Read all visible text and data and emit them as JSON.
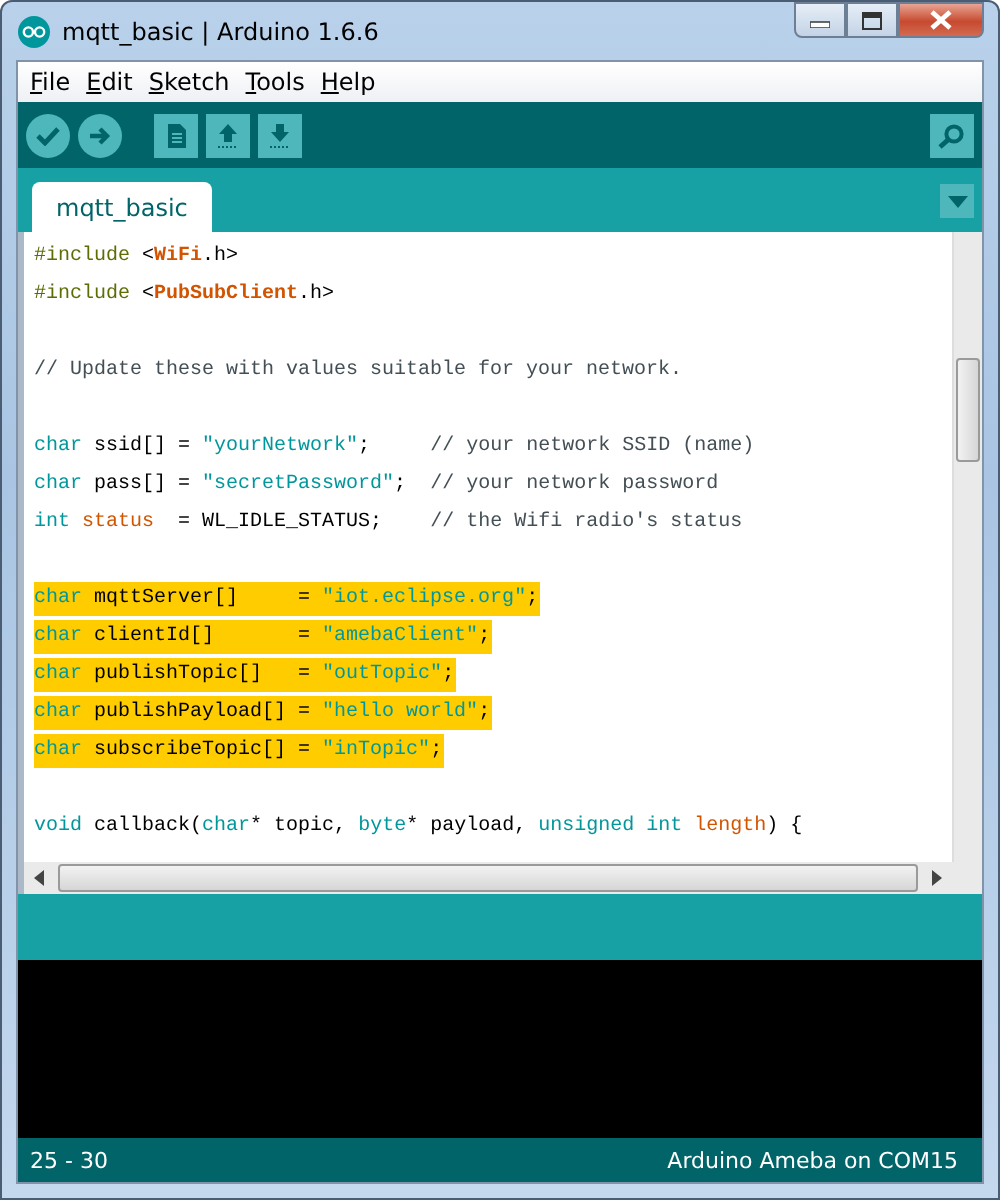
{
  "window": {
    "title": "mqtt_basic | Arduino 1.6.6"
  },
  "menu": [
    "File",
    "Edit",
    "Sketch",
    "Tools",
    "Help"
  ],
  "tabs": [
    {
      "label": "mqtt_basic",
      "selected": true
    }
  ],
  "code": {
    "lines": [
      {
        "highlighted": false,
        "tokens": [
          {
            "kind": "preprocessor",
            "text": "#include"
          },
          {
            "kind": "plain",
            "text": " <"
          },
          {
            "kind": "library",
            "text": "WiFi"
          },
          {
            "kind": "plain",
            "text": ".h>"
          }
        ]
      },
      {
        "highlighted": false,
        "tokens": [
          {
            "kind": "preprocessor",
            "text": "#include"
          },
          {
            "kind": "plain",
            "text": " <"
          },
          {
            "kind": "library",
            "text": "PubSubClient"
          },
          {
            "kind": "plain",
            "text": ".h>"
          }
        ]
      },
      {
        "highlighted": false
      },
      {
        "highlighted": false,
        "tokens": [
          {
            "kind": "comment",
            "text": "// Update these with values suitable for your network."
          }
        ]
      },
      {
        "highlighted": false
      },
      {
        "highlighted": false,
        "tokens": [
          {
            "kind": "keyword",
            "text": "char"
          },
          {
            "kind": "plain",
            "text": " ssid[] = "
          },
          {
            "kind": "string",
            "text": "\"yourNetwork\""
          },
          {
            "kind": "plain",
            "text": ";     "
          },
          {
            "kind": "comment",
            "text": "// your network SSID (name)"
          }
        ]
      },
      {
        "highlighted": false,
        "tokens": [
          {
            "kind": "keyword",
            "text": "char"
          },
          {
            "kind": "plain",
            "text": " pass[] = "
          },
          {
            "kind": "string",
            "text": "\"secretPassword\""
          },
          {
            "kind": "plain",
            "text": ";  "
          },
          {
            "kind": "comment",
            "text": "// your network password"
          }
        ]
      },
      {
        "highlighted": false,
        "tokens": [
          {
            "kind": "keyword",
            "text": "int "
          },
          {
            "kind": "variable",
            "text": "status"
          },
          {
            "kind": "plain",
            "text": "  = WL_IDLE_STATUS;    "
          },
          {
            "kind": "comment",
            "text": "// the Wifi radio's status"
          }
        ]
      },
      {
        "highlighted": false
      },
      {
        "highlighted": true,
        "tokens": [
          {
            "kind": "keyword",
            "text": "char"
          },
          {
            "kind": "plain",
            "text": " mqttServer[]     = "
          },
          {
            "kind": "string",
            "text": "\"iot.eclipse.org\""
          },
          {
            "kind": "plain",
            "text": ";"
          }
        ]
      },
      {
        "highlighted": true,
        "tokens": [
          {
            "kind": "keyword",
            "text": "char"
          },
          {
            "kind": "plain",
            "text": " clientId[]       = "
          },
          {
            "kind": "string",
            "text": "\"amebaClient\""
          },
          {
            "kind": "plain",
            "text": ";"
          }
        ]
      },
      {
        "highlighted": true,
        "tokens": [
          {
            "kind": "keyword",
            "text": "char"
          },
          {
            "kind": "plain",
            "text": " publishTopic[]   = "
          },
          {
            "kind": "string",
            "text": "\"outTopic\""
          },
          {
            "kind": "plain",
            "text": ";"
          }
        ]
      },
      {
        "highlighted": true,
        "tokens": [
          {
            "kind": "keyword",
            "text": "char"
          },
          {
            "kind": "plain",
            "text": " publishPayload[] = "
          },
          {
            "kind": "string",
            "text": "\"hello world\""
          },
          {
            "kind": "plain",
            "text": ";"
          }
        ]
      },
      {
        "highlighted": true,
        "tokens": [
          {
            "kind": "keyword",
            "text": "char"
          },
          {
            "kind": "plain",
            "text": " subscribeTopic[] = "
          },
          {
            "kind": "string",
            "text": "\"inTopic\""
          },
          {
            "kind": "plain",
            "text": ";"
          }
        ]
      },
      {
        "highlighted": false
      },
      {
        "highlighted": false,
        "tokens": [
          {
            "kind": "keyword",
            "text": "void"
          },
          {
            "kind": "plain",
            "text": " callback("
          },
          {
            "kind": "keyword",
            "text": "char"
          },
          {
            "kind": "plain",
            "text": "* topic, "
          },
          {
            "kind": "keyword",
            "text": "byte"
          },
          {
            "kind": "plain",
            "text": "* payload, "
          },
          {
            "kind": "keyword",
            "text": "unsigned int "
          },
          {
            "kind": "variable",
            "text": "length"
          },
          {
            "kind": "plain",
            "text": ") {"
          }
        ]
      }
    ]
  },
  "status_bar": {
    "line_range": "25 - 30",
    "board": "Arduino Ameba on COM15"
  }
}
